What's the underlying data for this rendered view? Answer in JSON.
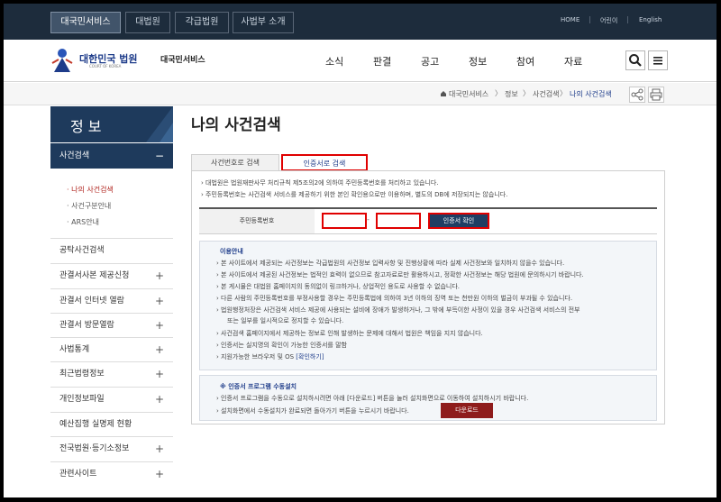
{
  "topbar": {
    "tabs": [
      "대국민서비스",
      "대법원",
      "각급법원",
      "사법부 소개"
    ],
    "utility": [
      "HOME",
      "어린이",
      "English"
    ]
  },
  "header": {
    "court_name": "대한민국 법원",
    "court_en": "COURT OF KOREA",
    "service": "대국민서비스",
    "nav": [
      "소식",
      "판결",
      "공고",
      "정보",
      "참여",
      "자료"
    ]
  },
  "breadcrumb": [
    "대국민서비스",
    "정보",
    "사건검색",
    "나의 사건검색"
  ],
  "sidebar": {
    "title": "정 보",
    "active": "사건검색",
    "active_icon": "−",
    "subitems": [
      "나의 사건검색",
      "사건구분안내",
      "ARS안내"
    ],
    "items": [
      {
        "label": "공탁사건검색",
        "icon": ""
      },
      {
        "label": "관결서사본 제공신청",
        "icon": "+"
      },
      {
        "label": "관결서 인터넷 열람",
        "icon": "+"
      },
      {
        "label": "관결서 방문열람",
        "icon": "+"
      },
      {
        "label": "사법통계",
        "icon": "+"
      },
      {
        "label": "최근법령정보",
        "icon": "+"
      },
      {
        "label": "개인정보파일",
        "icon": "+"
      },
      {
        "label": "예산집행 실명제 현황",
        "icon": ""
      },
      {
        "label": "전국법원·등기소정보",
        "icon": "+"
      },
      {
        "label": "관련사이트",
        "icon": "+"
      }
    ]
  },
  "page_title": "나의 사건검색",
  "tabs": [
    "사건번호로 검색",
    "인증서로 검색"
  ],
  "notes": [
    "대법원은 법원재판사무 처리규칙 제5조의2에 의하여 주민등록번호를 처리하고 있습니다.",
    "주민등록번호는 사건검색 서비스를 제공하기 위한 본인 확인용으로만 이용하며, 별도의 DB에 저장되지는 않습니다."
  ],
  "form": {
    "label": "주민등록번호",
    "separator": "-",
    "confirm_button": "인증서 확인"
  },
  "info": {
    "heading": "이용안내",
    "items": [
      "본 사이트에서 제공되는 사건정보는 각급법원의 사건정보 입력사항 및 진행상황에 따라 실제 사건정보와 일치하지 않을수 있습니다.",
      "본 사이트에서 제공된 사건정보는 법적인 효력이 없으므로 참고자료로만 활용하시고, 정확한 사건정보는 해당 법원에 문의하시기 바랍니다.",
      "본 게시물은 대법원 홈페이지의 동의없이 링크하거나, 상업적인 용도로 사용할 수 없습니다.",
      "다른 사람의 주민등록번호를 부정사용할 경우는 주민등록법에 의하여 3년 이하의 징역 또는 천만원 이하의 벌금이 부과될 수 있습니다.",
      "법원행정처장은 사건검색 서비스 제공에 사용되는 설비에 장애가 발생하거나, 그 밖에 부득이한 사정이 있을 경우 사건검색 서비스의 전부",
      "사건검색 홈페이지에서 제공하는 정보로 인해 발생하는 문제에 대해서 법원은 책임을 지지 않습니다.",
      "인증서는 실지명의 확인이 가능한 인증서를 말함"
    ],
    "item5_cont": "또는 일부를 일시적으로 정지할 수 있습니다.",
    "last_text": "지원가능한 브라우저 및 OS",
    "last_link": "[확인하기]"
  },
  "download": {
    "heading": "※ 인증서 프로그램 수동설치",
    "line1": "인증서 프로그램을 수동으로 설치하시려면 아래 [다운로드] 버튼을 눌러 설치화면으로 이동하여 설치하시기 바랍니다.",
    "line2": "설치화면에서 수동설치가 완료되면 돌아가기 버튼을 누르시기 바랍니다.",
    "button": "다운로드"
  }
}
